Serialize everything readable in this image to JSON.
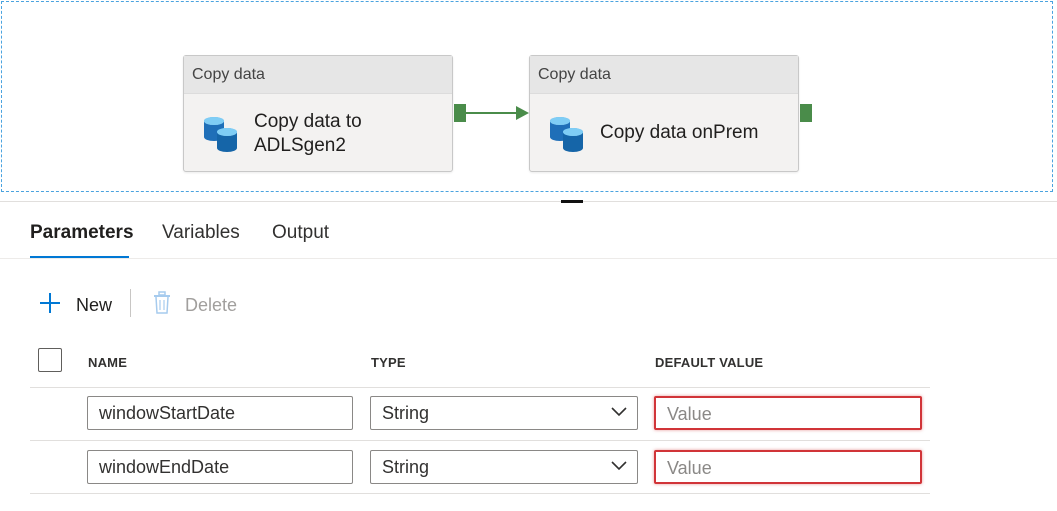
{
  "pipeline": {
    "activities": [
      {
        "type_label": "Copy data",
        "title_line1": "Copy data to",
        "title_line2": "ADLSgen2",
        "icon": "database-icon"
      },
      {
        "type_label": "Copy data",
        "title_line1": "Copy data onPrem",
        "icon": "database-icon"
      }
    ],
    "colors": {
      "port": "#4a8c4a",
      "connector": "#4a8c4a",
      "selection_border": "#4aa3df",
      "accent": "#0078d4",
      "error": "#d13438"
    }
  },
  "tabs": [
    {
      "label": "Parameters",
      "active": true
    },
    {
      "label": "Variables",
      "active": false
    },
    {
      "label": "Output",
      "active": false
    }
  ],
  "toolbar": {
    "new_label": "New",
    "new_icon": "plus-icon",
    "delete_label": "Delete",
    "delete_icon": "trash-icon",
    "delete_disabled": true
  },
  "table": {
    "columns": [
      "NAME",
      "TYPE",
      "DEFAULT VALUE"
    ],
    "rows": [
      {
        "name": "windowStartDate",
        "type": "String",
        "default_value": "",
        "default_placeholder": "Value"
      },
      {
        "name": "windowEndDate",
        "type": "String",
        "default_value": "",
        "default_placeholder": "Value"
      }
    ]
  }
}
